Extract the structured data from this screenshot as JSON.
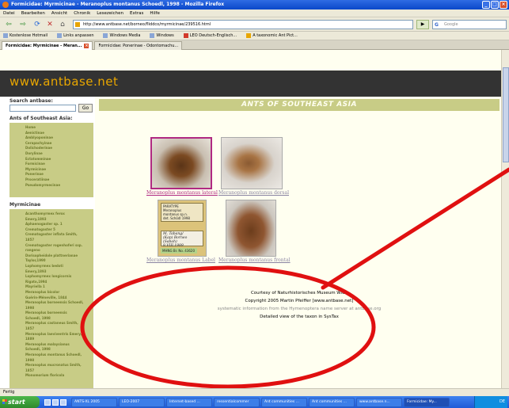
{
  "window": {
    "title": "Formicidae: Myrmicinae - Meranoplus montanus Schoedl, 1998 - Mozilla Firefox",
    "controls": [
      "_",
      "□",
      "×"
    ]
  },
  "menubar": [
    "Datei",
    "Bearbeiten",
    "Ansicht",
    "Chronik",
    "Lesezeichen",
    "Extras",
    "Hilfe"
  ],
  "nav": {
    "back": "⇦",
    "forward": "⇨",
    "reload": "⟳",
    "stop": "✕",
    "home": "⌂",
    "url": "http://www.antbase.net/borneo/fliddco/myrmicinae/239516.html",
    "go": "▶",
    "search_engine": "G",
    "search_placeholder": "Google"
  },
  "bookmarks": [
    "Kostenlose Hotmail",
    "Links anpassen",
    "Windows Media",
    "Windows",
    "LEO Deutsch-Englisch...",
    "A taxonomic Ant Pict..."
  ],
  "tabs": [
    {
      "label": "Formicidae: Myrmicinae - Meran...",
      "active": true
    },
    {
      "label": "Formicidae: Ponerinae - Odontomachu...",
      "active": false
    }
  ],
  "site": {
    "brand": "www.antbase.net",
    "banner": "ANTS OF SOUTHEAST ASIA"
  },
  "sidebar": {
    "search_label": "Search antbase:",
    "go_label": "Go",
    "section1_title": "Ants of Southeast Asia:",
    "section1_items": [
      "Home",
      "Aenictinae",
      "Amblyoponinae",
      "Cerapachyinae",
      "Dolichoderinae",
      "Dorylinae",
      "Ectatomminae",
      "Formicinae",
      "Myrmicinae",
      "Ponerinae",
      "Proceratiinae",
      "Pseudomyrmecinae"
    ],
    "section2_title": "Myrmicinae",
    "section2_items": [
      "Acanthomyrmex ferox",
      "Emery,1893",
      "Aphaenogaster sp. 1",
      "Crematogaster 5",
      "Crematogaster inflata Smith,",
      "1857",
      "Crematogaster rogenhoferi ssp.",
      "rangeno",
      "Dorisopheidole plattnerianae",
      "Taylor,1990",
      "Lophomyrmex bedoti",
      "Emery,1893",
      "Lophomyrmex longicornis",
      "Rigato,1994",
      "Mayriella 1",
      "Meranoplus bicolor",
      "Guérin-Méneville, 1844",
      "Meranoplus borneensis Schoedl,",
      "1998",
      "Meranoplus borneensis",
      "Schoedl, 1998",
      "Meranoplus castaneus Smith,",
      "1857",
      "Meranoplus laeviventris Emery,",
      "1889",
      "Meranoplus malaysianus",
      "Schoedl, 1998",
      "Meranoplus montanus Schoedl,",
      "1998",
      "Meranoplus mucronatus Smith,",
      "1857",
      "Monomorium floricola"
    ]
  },
  "images": {
    "caption_row1": [
      "Meranoplus montanus lateral",
      "Meranoplus montanus dorsal"
    ],
    "caption_row2": [
      "Meranoplus montanus Label",
      "Meranoplus montanus frontal"
    ],
    "specimen_label": [
      "PARATYPE",
      "Meranoplus",
      "montanus sp.n.",
      "det. Schödl 1998"
    ],
    "specimen_handwritten": [
      "M. Tabang/",
      "(Kap) Borneo",
      "(Sabah)",
      "8.VIII.1989"
    ],
    "specimen_collection": "MHNG Br. No. 43620"
  },
  "footer": {
    "courtesy": "Courtesy of Naturhistorisches Museum Wien",
    "copyright": "Copyright 2005 Martin Pfeiffer [www.antbase.net]",
    "systematic": "systematic information from the Hymenoptera name server at antbase.org",
    "detailed": "Detailed view of the taxon in SysTax"
  },
  "status": "Fertig",
  "taskbar": {
    "start": "start",
    "tasks": [
      "ANTS-XL 2005",
      "LEO-2007",
      "Internet-based ...",
      "ressentialcommer",
      "Ant communities ...",
      "Ant communities ...",
      "www.antbase.n...",
      "Formicidae: My..."
    ],
    "tray": "DE"
  },
  "colors": {
    "brand": "#e8a600",
    "header_bg": "#333333",
    "page_bg": "#fffff0",
    "sidebar_box": "#c8cc86",
    "sidebar_link": "#6f7a2c",
    "link": "#b02a82",
    "annotation": "#e01010"
  }
}
